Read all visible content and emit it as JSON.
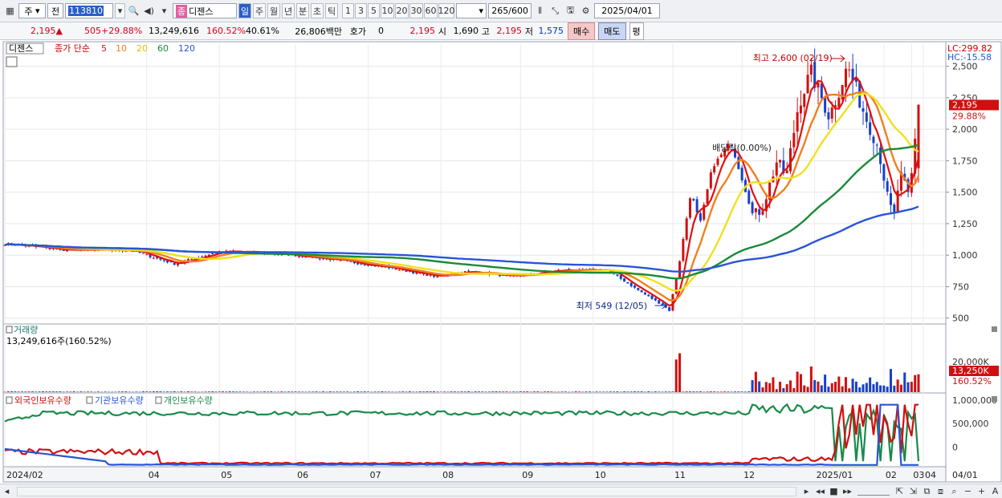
{
  "toolbar": {
    "market": "주",
    "market2": "전",
    "code": "113810",
    "name": "디젠스",
    "period_day": "일",
    "period_week": "주",
    "period_month": "월",
    "period_year": "년",
    "period_min": "분",
    "period_sec": "초",
    "period_tick": "틱",
    "nums": [
      "1",
      "3",
      "5",
      "10",
      "20",
      "30",
      "60",
      "120"
    ],
    "count": "265",
    "count_max": "/600",
    "date": "2025/04/01"
  },
  "quote": {
    "price": "2,195",
    "change": "505",
    "change_pct": "+29.88%",
    "volume": "13,249,616",
    "vol_ratio": "160.52%",
    "turnover": "40.61%",
    "amount": "26,806백만",
    "bid_label": "호가",
    "bid_val": "0",
    "ask_val": "2,195",
    "open_label": "시",
    "open": "1,690",
    "high_label": "고",
    "high": "2,195",
    "low_label": "저",
    "low": "1,575",
    "buy": "매수",
    "sell": "매도",
    "avg": "평"
  },
  "price_panel": {
    "name": "디젠스",
    "indicator": "종가 단순",
    "ma": [
      "5",
      "10",
      "20",
      "60",
      "120"
    ],
    "hi_label": "최고 2,600 (02/19)",
    "lo_label": "최저 549 (12/05)",
    "div_label": "배당락(0.00%)",
    "lc": "LC:299.82",
    "hc": "HC:-15.58",
    "price_tag": "2,195",
    "pct_tag": "29.88%",
    "y_ticks": [
      "2,500",
      "2,250",
      "2,000",
      "1,750",
      "1,500",
      "1,250",
      "1,000",
      "750",
      "500"
    ],
    "colors": {
      "ma5": "#e01010",
      "ma10": "#f08020",
      "ma20": "#f0e020",
      "ma60": "#1a8a3a",
      "ma120": "#2855d8",
      "up": "#d01010",
      "down": "#1840c8"
    }
  },
  "volume_panel": {
    "title": "거래량",
    "value": "13,249,616주(160.52%)",
    "tick": "20,000K",
    "tag": "13,250K",
    "tag2": "160.52%"
  },
  "holding_panel": {
    "s1": "외국인보유수량",
    "s2": "기관보유수량",
    "s3": "개인보유수량",
    "ticks": [
      "1,000,000",
      "500,000",
      "0"
    ]
  },
  "x_axis": [
    "2024/02",
    "04",
    "05",
    "06",
    "07",
    "08",
    "09",
    "10",
    "11",
    "12",
    "2025/01",
    "02",
    "03",
    "04",
    "04/01"
  ],
  "chart_data": [
    {
      "type": "candlestick",
      "title": "디젠스",
      "ylim": [
        460,
        2650
      ],
      "x": [
        "2024/02",
        "04",
        "05",
        "06",
        "07",
        "08",
        "09",
        "10",
        "11",
        "12",
        "2025/01",
        "02",
        "03",
        "04"
      ],
      "close": [
        1080,
        1040,
        940,
        1050,
        990,
        830,
        850,
        830,
        880,
        620,
        1950,
        1650,
        2500,
        1600,
        2195
      ],
      "annotations": [
        "최고 2,600 (02/19)",
        "최저 549 (12/05)",
        "배당락(0.00%)"
      ],
      "series": [
        {
          "name": "5"
        },
        {
          "name": "10"
        },
        {
          "name": "20"
        },
        {
          "name": "60"
        },
        {
          "name": "120"
        }
      ]
    },
    {
      "type": "bar",
      "title": "거래량",
      "values_last": 13249616,
      "unit": "주"
    },
    {
      "type": "line",
      "title": "보유수량",
      "series": [
        {
          "name": "외국인보유수량"
        },
        {
          "name": "기관보유수량"
        },
        {
          "name": "개인보유수량"
        }
      ],
      "ylim": [
        -400000,
        1100000
      ]
    }
  ]
}
